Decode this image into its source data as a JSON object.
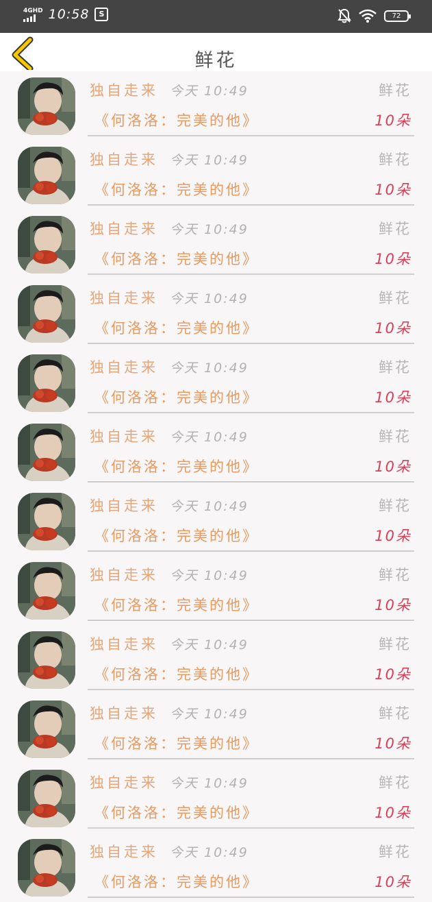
{
  "status_bar": {
    "network": "4GHD",
    "time": "10:58",
    "battery": "72",
    "icons": [
      "signal-icon",
      "s-app-icon",
      "bell-off-icon",
      "wifi-icon",
      "battery-icon"
    ]
  },
  "nav": {
    "title": "鲜花",
    "back_icon": "chevron-left-icon",
    "accent_color": "#f5c800"
  },
  "list": {
    "items": [
      {
        "sender": "独自走来",
        "time": "今天 10:49",
        "type": "鲜花",
        "book": "《何洛洛：完美的他》",
        "count": "10朵"
      },
      {
        "sender": "独自走来",
        "time": "今天 10:49",
        "type": "鲜花",
        "book": "《何洛洛：完美的他》",
        "count": "10朵"
      },
      {
        "sender": "独自走来",
        "time": "今天 10:49",
        "type": "鲜花",
        "book": "《何洛洛：完美的他》",
        "count": "10朵"
      },
      {
        "sender": "独自走来",
        "time": "今天 10:49",
        "type": "鲜花",
        "book": "《何洛洛：完美的他》",
        "count": "10朵"
      },
      {
        "sender": "独自走来",
        "time": "今天 10:49",
        "type": "鲜花",
        "book": "《何洛洛：完美的他》",
        "count": "10朵"
      },
      {
        "sender": "独自走来",
        "time": "今天 10:49",
        "type": "鲜花",
        "book": "《何洛洛：完美的他》",
        "count": "10朵"
      },
      {
        "sender": "独自走来",
        "time": "今天 10:49",
        "type": "鲜花",
        "book": "《何洛洛：完美的他》",
        "count": "10朵"
      },
      {
        "sender": "独自走来",
        "time": "今天 10:49",
        "type": "鲜花",
        "book": "《何洛洛：完美的他》",
        "count": "10朵"
      },
      {
        "sender": "独自走来",
        "time": "今天 10:49",
        "type": "鲜花",
        "book": "《何洛洛：完美的他》",
        "count": "10朵"
      },
      {
        "sender": "独自走来",
        "time": "今天 10:49",
        "type": "鲜花",
        "book": "《何洛洛：完美的他》",
        "count": "10朵"
      },
      {
        "sender": "独自走来",
        "time": "今天 10:49",
        "type": "鲜花",
        "book": "《何洛洛：完美的他》",
        "count": "10朵"
      },
      {
        "sender": "独自走来",
        "time": "今天 10:49",
        "type": "鲜花",
        "book": "《何洛洛：完美的他》",
        "count": "10朵"
      }
    ]
  }
}
